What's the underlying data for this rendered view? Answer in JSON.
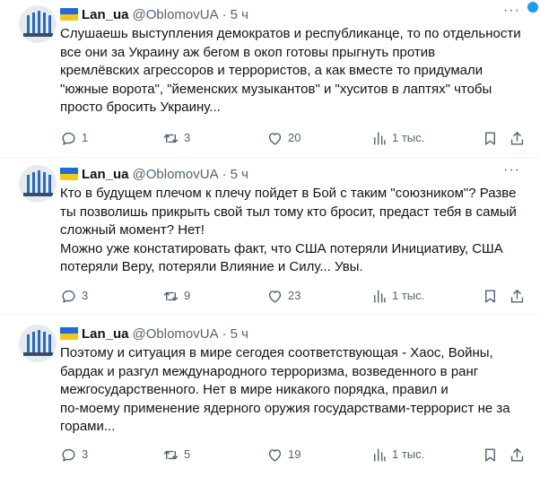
{
  "accent_color": "#1d9bf0",
  "tweets": [
    {
      "author": "Lan_ua",
      "handle": "@OblomovUA",
      "dot": "·",
      "time": "5 ч",
      "lines": [
        "Слушаешь выступления демократов и республиканце, то по отдельности",
        "все они за Украину аж бегом в окоп готовы прыгнуть против",
        "кремлёвских агрессоров и террористов, а как вместе то придумали",
        "\"южные ворота\", \"йеменских музыкантов\" и \"хуситов в лаптях\" чтобы",
        "просто бросить Украину..."
      ],
      "replies": "1",
      "retweets": "3",
      "likes": "20",
      "views": "1 тыс."
    },
    {
      "author": "Lan_ua",
      "handle": "@OblomovUA",
      "dot": "·",
      "time": "5 ч",
      "lines": [
        "Кто в будущем плечом к плечу пойдет в Бой с таким \"союзником\"? Разве",
        "ты позволишь прикрыть свой тыл тому кто бросит,  предаст тебя в самый",
        "сложный момент? Нет!",
        "Можно уже констатировать факт, что США потеряли Инициативу, США",
        "потеряли Веру, потеряли Влияние и Силу... Увы."
      ],
      "replies": "3",
      "retweets": "9",
      "likes": "23",
      "views": "1 тыс."
    },
    {
      "author": "Lan_ua",
      "handle": "@OblomovUA",
      "dot": "·",
      "time": "5 ч",
      "lines": [
        "Поэтому и ситуация в мире сегодея соответствующая - Хаос, Войны,",
        "бардак и разгул международного терроризма, возведенного в ранг",
        "межгосударственного. Нет в мире никакого порядка, правил и",
        "по-моему применение ядерного оружия государствами-террорист не за",
        "горами..."
      ],
      "replies": "3",
      "retweets": "5",
      "likes": "19",
      "views": "1 тыс."
    }
  ]
}
